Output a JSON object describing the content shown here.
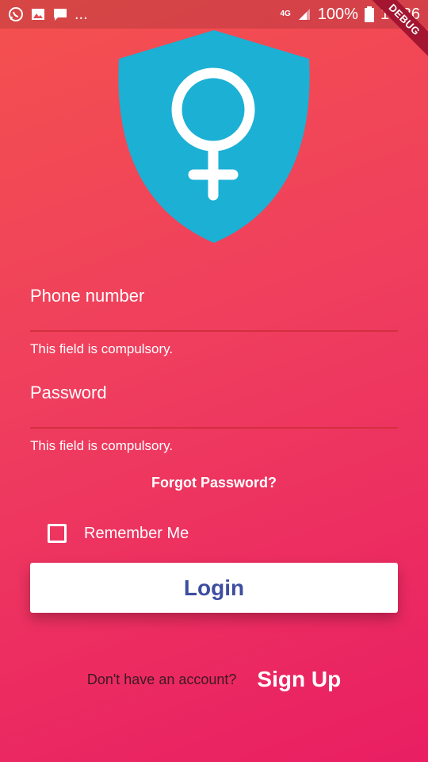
{
  "status_bar": {
    "left_icons": [
      "whatsapp-icon",
      "image-icon",
      "message-icon"
    ],
    "more": "...",
    "network": "4G",
    "battery": "100%",
    "time": "15:36"
  },
  "debug_banner": "DEBUG",
  "logo": {
    "icon": "female-shield-icon",
    "shield_color": "#1bb0d4"
  },
  "form": {
    "phone": {
      "label": "Phone number",
      "error": "This field is compulsory."
    },
    "password": {
      "label": "Password",
      "error": "This field is compulsory."
    },
    "forgot_password": "Forgot Password?",
    "remember_me": {
      "label": "Remember Me",
      "checked": false
    },
    "login_button": "Login"
  },
  "footer": {
    "prompt": "Don't have an account?",
    "signup": "Sign Up"
  },
  "colors": {
    "gradient_start": "#f4514e",
    "gradient_end": "#e91e63",
    "button_text": "#3d4ea0"
  }
}
